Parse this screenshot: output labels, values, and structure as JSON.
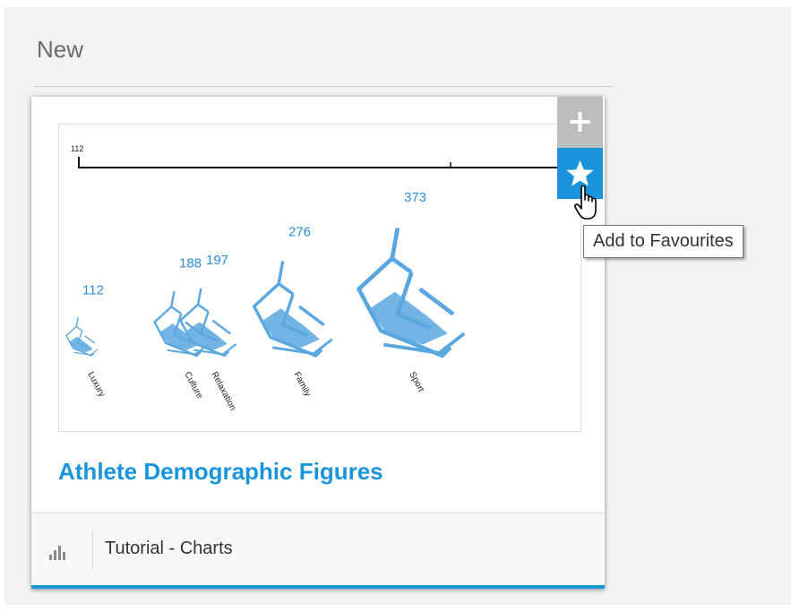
{
  "section": {
    "title": "New"
  },
  "card": {
    "title": "Athlete Demographic Figures",
    "footer": {
      "label": "Tutorial - Charts",
      "icon": "bar-chart-icon"
    },
    "actions": {
      "add_icon": "plus-icon",
      "favourite_icon": "star-icon",
      "favourite_tooltip": "Add to Favourites"
    }
  },
  "colors": {
    "accent": "#1a95dc",
    "panel_bg": "#f2f2f2",
    "add_button": "#bdbdbd"
  },
  "chart_data": {
    "type": "bar",
    "axis_tick_label": "112",
    "categories": [
      "Luxury",
      "Culture",
      "Relaxation",
      "Family",
      "Sport"
    ],
    "values": [
      112,
      188,
      197,
      276,
      373
    ],
    "value_labels": [
      "112",
      "188",
      "197",
      "276",
      "373"
    ],
    "mark": "ski-lift-chair-icon",
    "color": "#5aa7e0"
  }
}
